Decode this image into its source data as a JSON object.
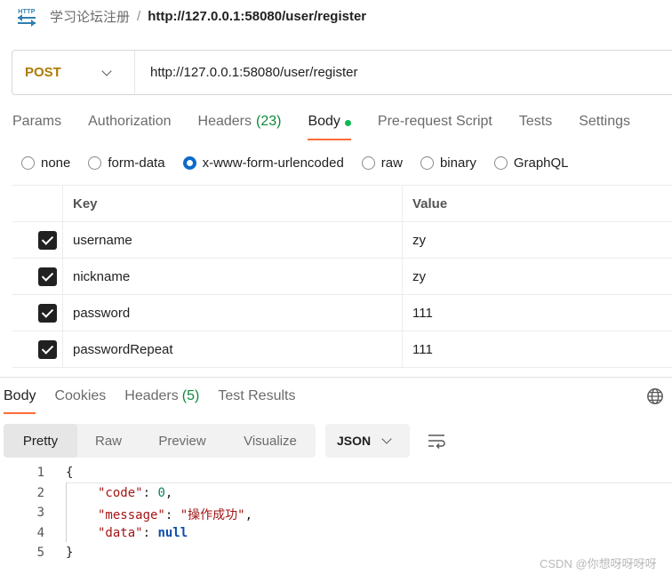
{
  "breadcrumb": {
    "collection": "学习论坛注册",
    "separator": "/",
    "request": "http://127.0.0.1:58080/user/register",
    "icon": "http-icon"
  },
  "request": {
    "method": "POST",
    "url": "http://127.0.0.1:58080/user/register",
    "method_color": "#ad7a03"
  },
  "req_tabs": [
    {
      "label": "Params"
    },
    {
      "label": "Authorization"
    },
    {
      "label": "Headers",
      "count": "(23)"
    },
    {
      "label": "Body",
      "active": true
    },
    {
      "label": "Pre-request Script"
    },
    {
      "label": "Tests"
    },
    {
      "label": "Settings"
    }
  ],
  "body_types": [
    {
      "label": "none"
    },
    {
      "label": "form-data"
    },
    {
      "label": "x-www-form-urlencoded",
      "selected": true
    },
    {
      "label": "raw"
    },
    {
      "label": "binary"
    },
    {
      "label": "GraphQL"
    }
  ],
  "params": {
    "key_header": "Key",
    "value_header": "Value",
    "rows": [
      {
        "key": "username",
        "value": "zy",
        "checked": true
      },
      {
        "key": "nickname",
        "value": "zy",
        "checked": true
      },
      {
        "key": "password",
        "value": "111",
        "checked": true
      },
      {
        "key": "passwordRepeat",
        "value": "111",
        "checked": true
      }
    ]
  },
  "res_tabs": [
    {
      "label": "Body",
      "active": true
    },
    {
      "label": "Cookies"
    },
    {
      "label": "Headers",
      "count": "(5)"
    },
    {
      "label": "Test Results"
    }
  ],
  "views": [
    "Pretty",
    "Raw",
    "Preview",
    "Visualize"
  ],
  "format": {
    "selected": "JSON"
  },
  "code": {
    "line_numbers": [
      "1",
      "2",
      "3",
      "4",
      "5"
    ],
    "open": "{",
    "close": "}",
    "fields": [
      {
        "key": "\"code\"",
        "colon": ": ",
        "value": "0",
        "comma": ","
      },
      {
        "key": "\"message\"",
        "colon": ": ",
        "value": "\"操作成功\"",
        "comma": ","
      },
      {
        "key": "\"data\"",
        "colon": ": ",
        "value": "null",
        "comma": ""
      }
    ]
  },
  "watermark": "CSDN @你想呀呀呀呀",
  "colors": {
    "accent": "#ff6c37",
    "count_green": "#0b8a3b",
    "dot_green": "#0cbb52",
    "radio_blue": "#0b6bcb"
  }
}
